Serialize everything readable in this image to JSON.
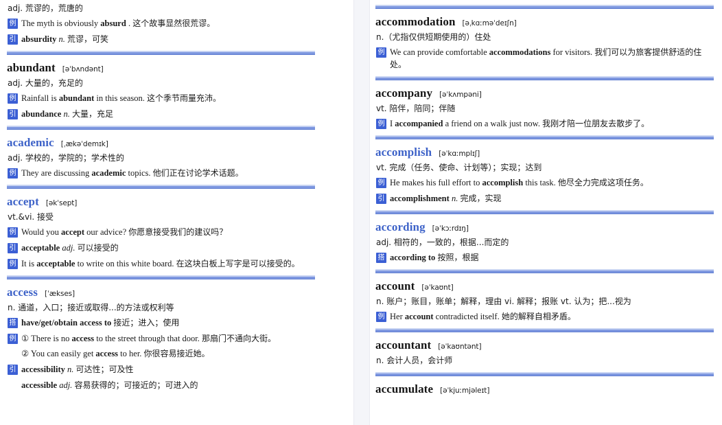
{
  "badges": {
    "example": "例",
    "derivative": "引",
    "collocation": "搭"
  },
  "colors": {
    "accent": "#3b5fd4",
    "separator": "#7d97e0",
    "headword_blue": "#3d62c8",
    "headword_black": "#151515"
  },
  "left_column": {
    "partial_top_entry": {
      "sense": "adj. 荒谬的，荒唐的",
      "rows": [
        {
          "badge": "例",
          "en_pre": "The myth is obviously ",
          "bold": "absurd",
          "en_post": " . ",
          "cn": "这个故事显然很荒谬。"
        },
        {
          "badge": "引",
          "bold": "absurdity",
          "pos": "n.",
          "cn": "荒谬，可笑"
        }
      ]
    },
    "entries": [
      {
        "headword": "abundant",
        "headword_color": "black",
        "phonetic": "[əˈbʌndənt]",
        "sense": "adj. 大量的，充足的",
        "rows": [
          {
            "badge": "例",
            "en_pre": "Rainfall is ",
            "bold": "abundant",
            "en_post": " in this season. ",
            "cn": "这个季节雨量充沛。"
          },
          {
            "badge": "引",
            "bold": "abundance",
            "pos": "n.",
            "cn": "大量，充足"
          }
        ]
      },
      {
        "headword": "academic",
        "headword_color": "blue",
        "phonetic": "[ˌækəˈdemɪk]",
        "sense": "adj. 学校的，学院的；学术性的",
        "rows": [
          {
            "badge": "例",
            "en_pre": "They are discussing ",
            "bold": "academic",
            "en_post": " topics. ",
            "cn": "他们正在讨论学术话题。"
          }
        ]
      },
      {
        "headword": "accept",
        "headword_color": "blue",
        "phonetic": "[əkˈsept]",
        "sense": "vt.&vi. 接受",
        "rows": [
          {
            "badge": "例",
            "en_pre": "Would you ",
            "bold": "accept",
            "en_post": " our advice? ",
            "cn": "你愿意接受我们的建议吗？"
          },
          {
            "badge": "引",
            "bold": "acceptable",
            "pos": "adj.",
            "cn": "可以接受的"
          },
          {
            "badge": "例",
            "en_pre": "It is ",
            "bold": "acceptable",
            "en_post": " to write on this white board. ",
            "cn": "在这块白板上写字是可以接受的。"
          }
        ]
      },
      {
        "headword": "access",
        "headword_color": "blue",
        "phonetic": "[ˈækses]",
        "sense": "n. 通道，入口；接近或取得...的方法或权利等",
        "rows": [
          {
            "badge": "搭",
            "en_pre": "have/get/obtain access to ",
            "cn": "接近；进入；使用"
          },
          {
            "badge": "例",
            "en_pre": "① There is no ",
            "bold": "access",
            "en_post": " to the street through that door. ",
            "cn": "那扇门不通向大街。"
          },
          {
            "badge": "",
            "en_pre": "② You can easily get ",
            "bold": "access",
            "en_post": " to her. ",
            "cn": "你很容易接近她。"
          },
          {
            "badge": "引",
            "bold": "accessibility",
            "pos": "n.",
            "cn": "可达性；可及性"
          },
          {
            "badge": "",
            "bold": "accessible",
            "pos": "adj.",
            "cn": "容易获得的；可接近的；可进入的"
          }
        ]
      }
    ]
  },
  "right_column": {
    "entries": [
      {
        "headword": "accommodation",
        "headword_color": "black",
        "phonetic": "[əˌkɑːməˈdeɪʃn]",
        "sense": "n.（尤指仅供短期使用的）住处",
        "rows": [
          {
            "badge": "例",
            "en_pre": "We can provide comfortable ",
            "bold": "accommodations",
            "en_post": " for visitors. ",
            "cn": "我们可以为旅客提供舒适的住处。"
          }
        ]
      },
      {
        "headword": "accompany",
        "headword_color": "black",
        "phonetic": "[əˈkʌmpəni]",
        "sense": "vt. 陪伴，陪同；伴随",
        "rows": [
          {
            "badge": "例",
            "en_pre": "I ",
            "bold": "accompanied",
            "en_post": " a friend on a walk just now. ",
            "cn": "我刚才陪一位朋友去散步了。"
          }
        ]
      },
      {
        "headword": "accomplish",
        "headword_color": "blue",
        "phonetic": "[əˈkɑːmplɪʃ]",
        "sense": "vt. 完成（任务、使命、计划等）；实现；达到",
        "rows": [
          {
            "badge": "例",
            "en_pre": "He makes his full effort to ",
            "bold": "accomplish",
            "en_post": " this task. ",
            "cn": "他尽全力完成这项任务。"
          },
          {
            "badge": "引",
            "bold": "accomplishment",
            "pos": "n.",
            "cn": "完成，实现"
          }
        ]
      },
      {
        "headword": "according",
        "headword_color": "blue",
        "phonetic": "[əˈkɔːrdɪŋ]",
        "sense": "adj. 相符的，一致的，根据...而定的",
        "rows": [
          {
            "badge": "搭",
            "en_pre": "according to ",
            "cn": "按照，根据"
          }
        ]
      },
      {
        "headword": "account",
        "headword_color": "black",
        "phonetic": "[əˈkaʊnt]",
        "sense": "n. 账户；账目，账单；解释，理由 vi. 解释；报账 vt. 认为；把...视为",
        "rows": [
          {
            "badge": "例",
            "en_pre": "Her ",
            "bold": "account",
            "en_post": " contradicted itself. ",
            "cn": "她的解释自相矛盾。"
          }
        ]
      },
      {
        "headword": "accountant",
        "headword_color": "black",
        "phonetic": "[əˈkaʊntənt]",
        "sense": "n. 会计人员，会计师",
        "rows": []
      },
      {
        "headword": "accumulate",
        "headword_color": "black",
        "phonetic": "[əˈkjuːmjəleɪt]",
        "sense": "",
        "rows": []
      }
    ]
  }
}
